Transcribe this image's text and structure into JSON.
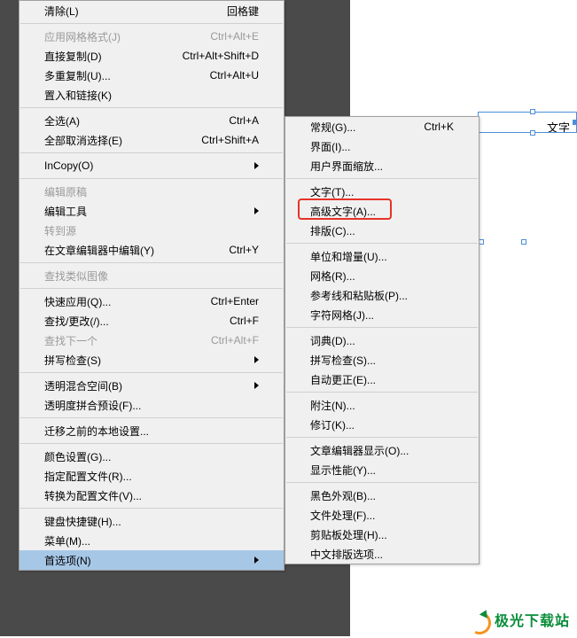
{
  "mainMenu": {
    "items": [
      {
        "label": "清除(L)",
        "shortcut": "回格键"
      },
      {
        "sep": true
      },
      {
        "label": "应用网格格式(J)",
        "shortcut": "Ctrl+Alt+E",
        "disabled": true
      },
      {
        "label": "直接复制(D)",
        "shortcut": "Ctrl+Alt+Shift+D"
      },
      {
        "label": "多重复制(U)...",
        "shortcut": "Ctrl+Alt+U"
      },
      {
        "label": "置入和链接(K)"
      },
      {
        "sep": true
      },
      {
        "label": "全选(A)",
        "shortcut": "Ctrl+A"
      },
      {
        "label": "全部取消选择(E)",
        "shortcut": "Ctrl+Shift+A"
      },
      {
        "sep": true
      },
      {
        "label": "InCopy(O)",
        "submenu": true
      },
      {
        "sep": true
      },
      {
        "label": "编辑原稿",
        "disabled": true
      },
      {
        "label": "编辑工具",
        "submenu": true
      },
      {
        "label": "转到源",
        "disabled": true
      },
      {
        "label": "在文章编辑器中编辑(Y)",
        "shortcut": "Ctrl+Y"
      },
      {
        "sep": true
      },
      {
        "label": "查找类似图像",
        "disabled": true
      },
      {
        "sep": true
      },
      {
        "label": "快速应用(Q)...",
        "shortcut": "Ctrl+Enter"
      },
      {
        "label": "查找/更改(/)...",
        "shortcut": "Ctrl+F"
      },
      {
        "label": "查找下一个",
        "shortcut": "Ctrl+Alt+F",
        "disabled": true
      },
      {
        "label": "拼写检查(S)",
        "submenu": true
      },
      {
        "sep": true
      },
      {
        "label": "透明混合空间(B)",
        "submenu": true
      },
      {
        "label": "透明度拼合预设(F)..."
      },
      {
        "sep": true
      },
      {
        "label": "迁移之前的本地设置..."
      },
      {
        "sep": true
      },
      {
        "label": "颜色设置(G)..."
      },
      {
        "label": "指定配置文件(R)..."
      },
      {
        "label": "转换为配置文件(V)..."
      },
      {
        "sep": true
      },
      {
        "label": "键盘快捷键(H)..."
      },
      {
        "label": "菜单(M)..."
      },
      {
        "label": "首选项(N)",
        "submenu": true,
        "highlighted": true
      }
    ]
  },
  "subMenu": {
    "items": [
      {
        "label": "常规(G)...",
        "shortcut": "Ctrl+K"
      },
      {
        "label": "界面(I)..."
      },
      {
        "label": "用户界面缩放..."
      },
      {
        "sep": true
      },
      {
        "label": "文字(T)..."
      },
      {
        "label": "高级文字(A)...",
        "redbox": true
      },
      {
        "label": "排版(C)..."
      },
      {
        "sep": true
      },
      {
        "label": "单位和增量(U)..."
      },
      {
        "label": "网格(R)..."
      },
      {
        "label": "参考线和粘贴板(P)..."
      },
      {
        "label": "字符网格(J)..."
      },
      {
        "sep": true
      },
      {
        "label": "词典(D)..."
      },
      {
        "label": "拼写检查(S)..."
      },
      {
        "label": "自动更正(E)..."
      },
      {
        "sep": true
      },
      {
        "label": "附注(N)..."
      },
      {
        "label": "修订(K)..."
      },
      {
        "sep": true
      },
      {
        "label": "文章编辑器显示(O)..."
      },
      {
        "label": "显示性能(Y)..."
      },
      {
        "sep": true
      },
      {
        "label": "黑色外观(B)..."
      },
      {
        "label": "文件处理(F)..."
      },
      {
        "label": "剪贴板处理(H)..."
      },
      {
        "label": "中文排版选项..."
      }
    ]
  },
  "pageFragment": {
    "text": "文字"
  },
  "watermark": {
    "text": "极光下载站"
  }
}
